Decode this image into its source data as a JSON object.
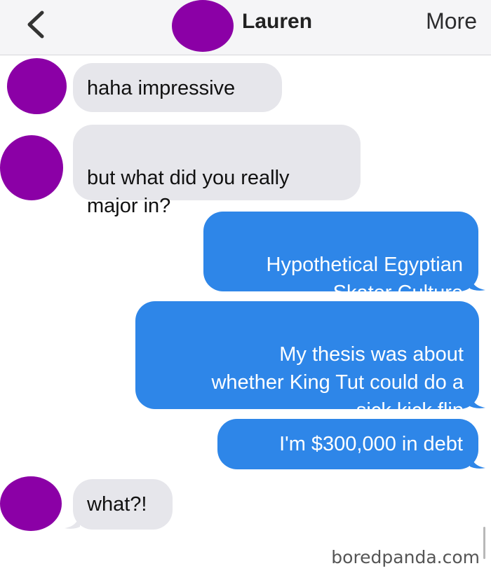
{
  "header": {
    "back_icon": "chevron-left-icon",
    "contact_name": "Lauren",
    "more_label": "More"
  },
  "colors": {
    "incoming_bubble": "#e6e6eb",
    "outgoing_bubble": "#2e86e8",
    "avatar": "#8b00a6"
  },
  "messages": [
    {
      "direction": "incoming",
      "text": "haha impressive"
    },
    {
      "direction": "incoming",
      "text": "but what did you really\nmajor in?"
    },
    {
      "direction": "outgoing",
      "text": "Hypothetical Egyptian\nSkater Culture"
    },
    {
      "direction": "outgoing",
      "text": "My thesis was about\nwhether King Tut could do a\nsick kick flip"
    },
    {
      "direction": "outgoing",
      "text": "I'm $300,000 in debt"
    },
    {
      "direction": "incoming",
      "text": "what?!"
    }
  ],
  "watermark": "boredpanda.com"
}
